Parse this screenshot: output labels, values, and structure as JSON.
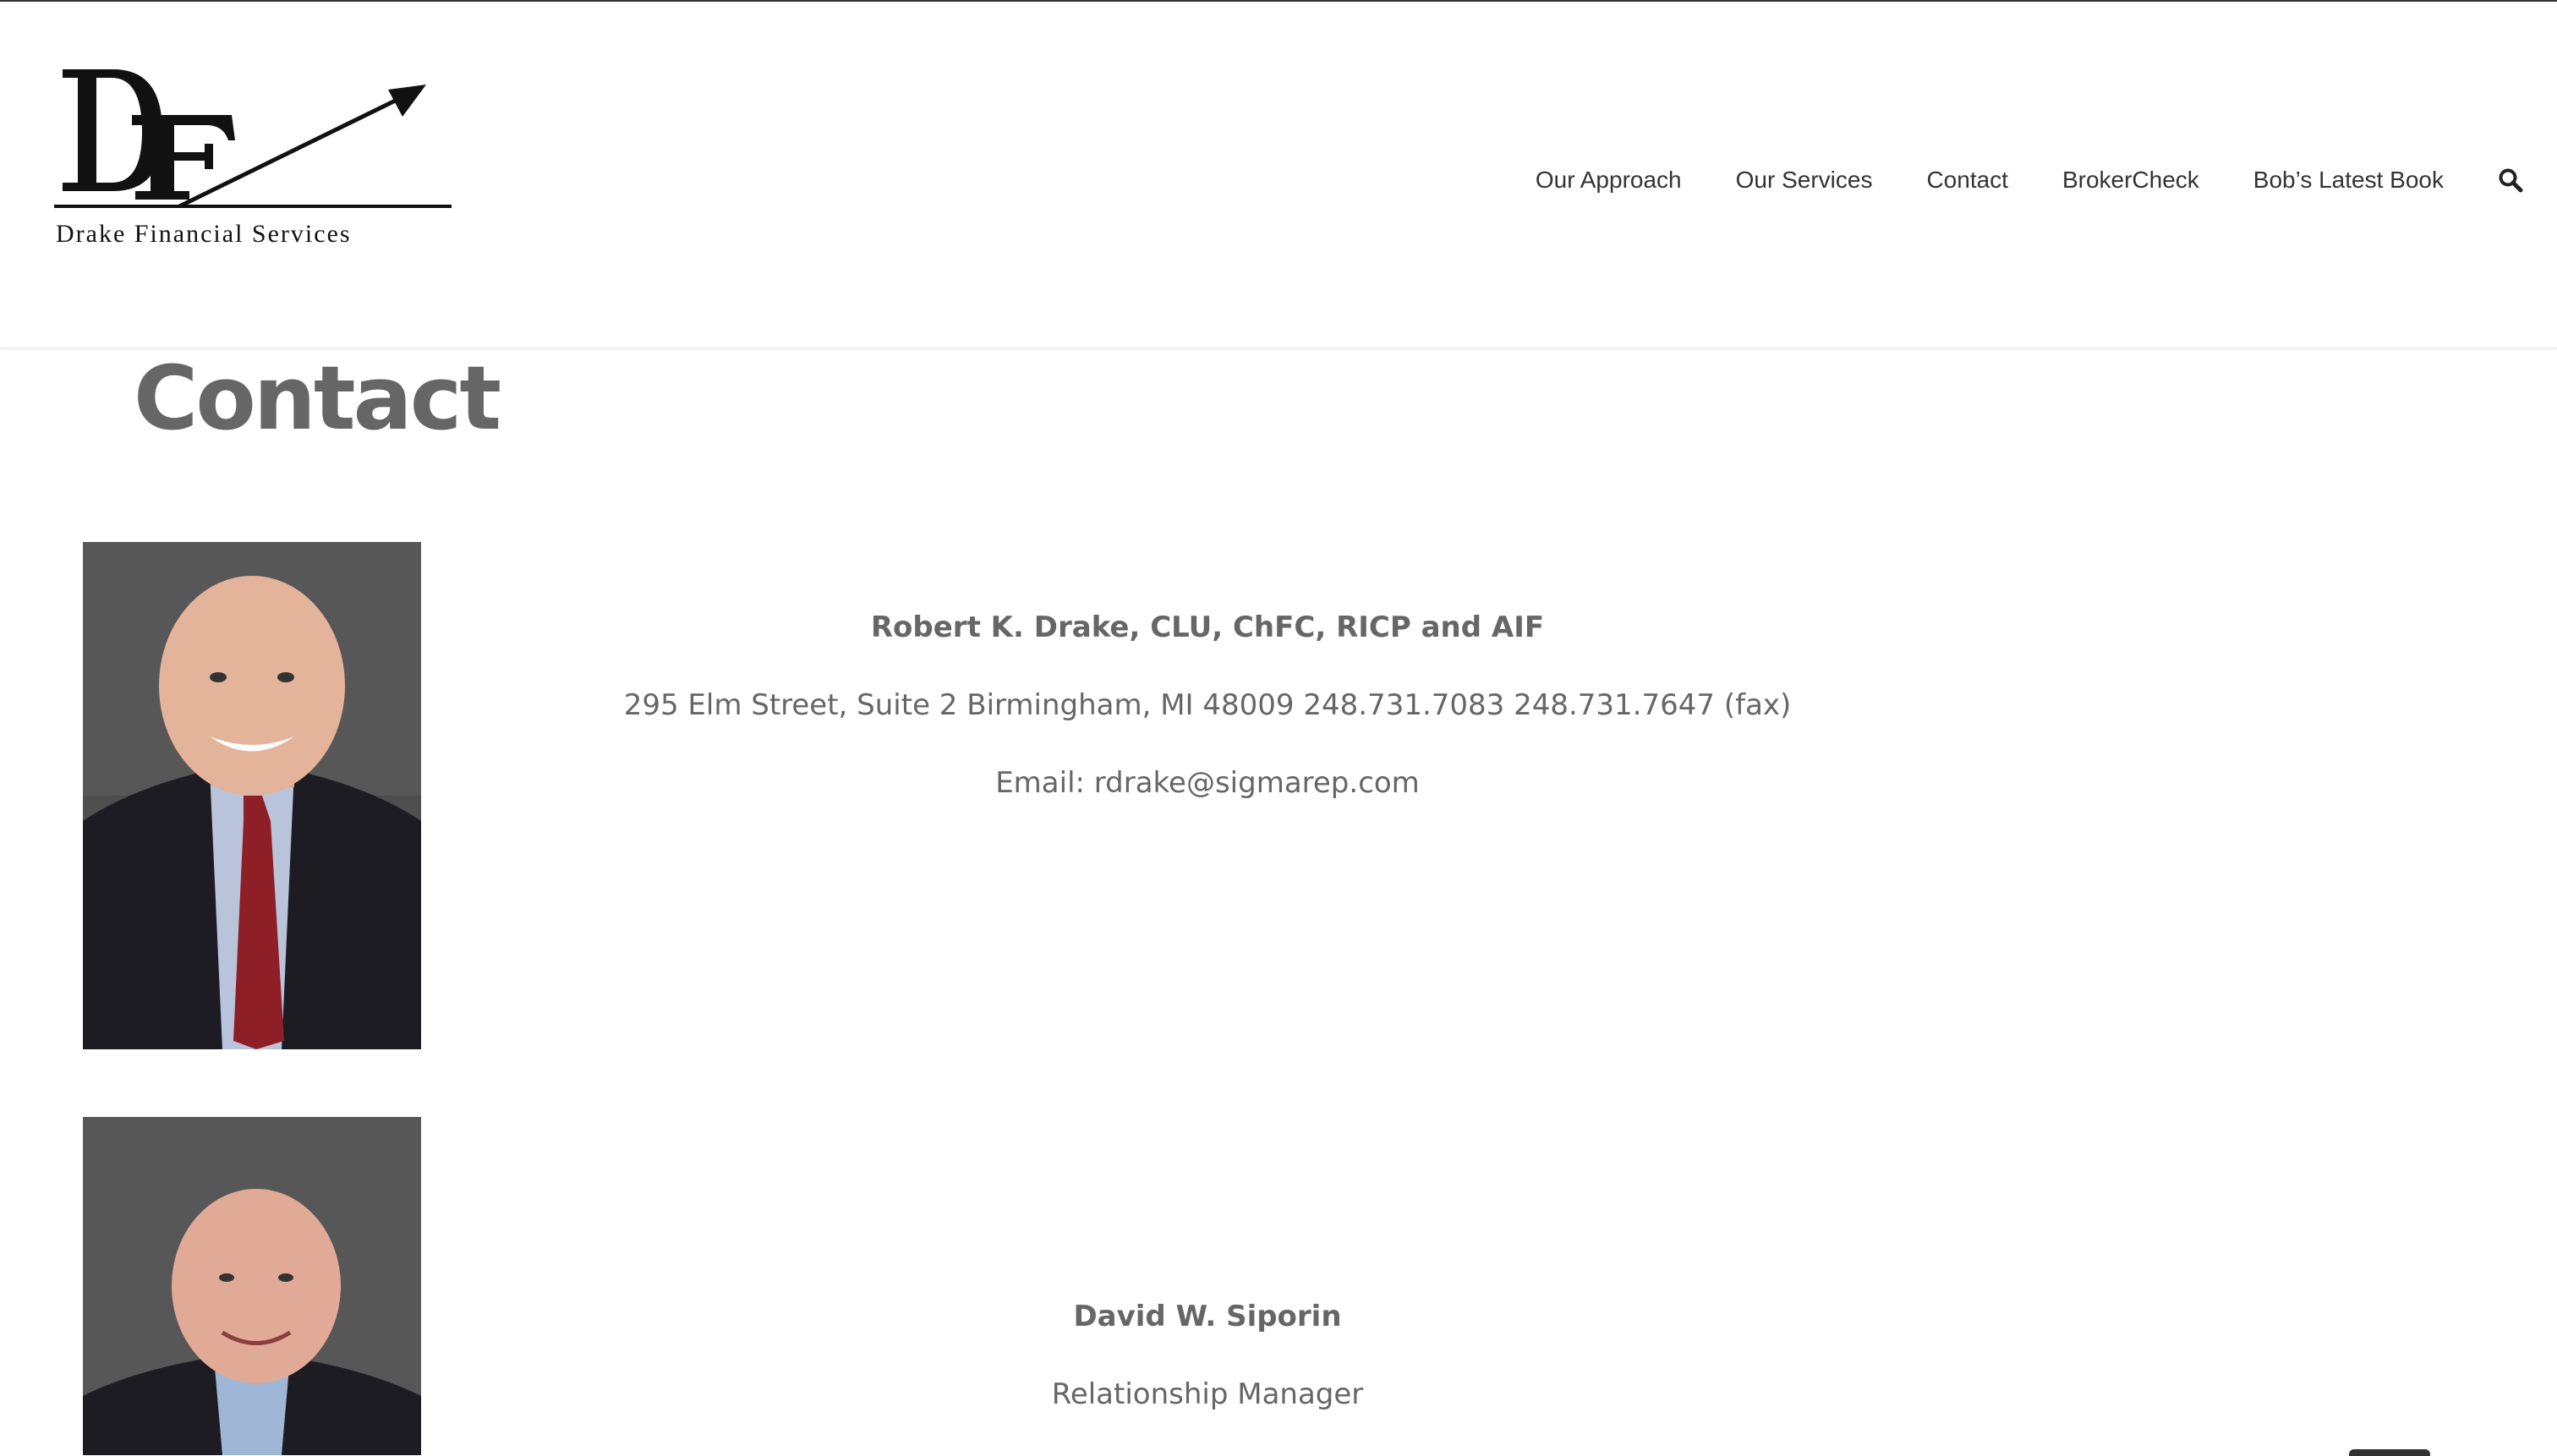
{
  "brand": {
    "logo_monogram": "DF",
    "logo_text": "Drake Financial Services"
  },
  "nav": {
    "items": [
      "Our Approach",
      "Our Services",
      "Contact",
      "BrokerCheck",
      "Bob’s Latest Book"
    ],
    "search_icon": "search-icon"
  },
  "page": {
    "title": "Contact"
  },
  "contacts": [
    {
      "name": "Robert K. Drake, CLU, ChFC, RICP and AIF",
      "address": "295 Elm Street, Suite 2 Birmingham, MI 48009 248.731.7083 248.731.7647 (fax)",
      "email": "Email: rdrake@sigmarep.com"
    },
    {
      "name": "David W. Siporin",
      "role": "Relationship Manager"
    }
  ],
  "colors": {
    "heading": "#666666",
    "nav_text": "#333333",
    "photo_bg": "#505050"
  }
}
